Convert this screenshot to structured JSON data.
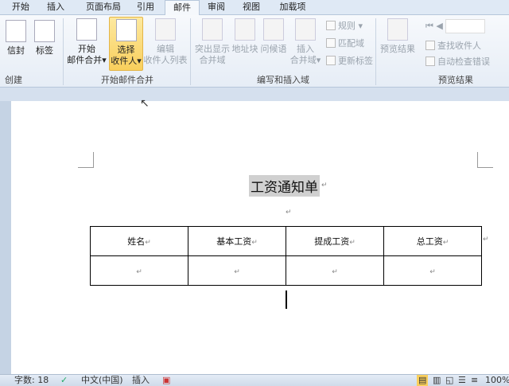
{
  "tabs": [
    "开始",
    "插入",
    "页面布局",
    "引用",
    "邮件",
    "审阅",
    "视图",
    "加载项"
  ],
  "active_tab": "邮件",
  "ribbon": {
    "create": {
      "label": "创建",
      "envelope": "信封",
      "labels": "标签"
    },
    "start_merge": {
      "label": "开始邮件合并",
      "start_line1": "开始",
      "start_line2": "邮件合并",
      "select_line1": "选择",
      "select_line2": "收件人",
      "edit_line1": "编辑",
      "edit_line2": "收件人列表"
    },
    "write_insert": {
      "label": "编写和插入域",
      "highlight_line1": "突出显示",
      "highlight_line2": "合并域",
      "address_block": "地址块",
      "greeting": "问候语",
      "insert_line1": "插入",
      "insert_line2": "合并域",
      "rules": "规则",
      "match_fields": "匹配域",
      "update_labels": "更新标签"
    },
    "preview": {
      "label": "预览结果",
      "preview_results": "预览结果",
      "find_recipient": "查找收件人",
      "auto_check": "自动检查错误"
    }
  },
  "document": {
    "title": "工资通知单",
    "table": {
      "headers": [
        "姓名",
        "基本工资",
        "提成工资",
        "总工资"
      ],
      "rows": [
        [
          "",
          "",
          "",
          ""
        ]
      ]
    },
    "para_mark": "↵"
  },
  "status": {
    "word_count": "字数: 18",
    "language": "中文(中国)",
    "mode": "插入",
    "zoom": "100%"
  }
}
